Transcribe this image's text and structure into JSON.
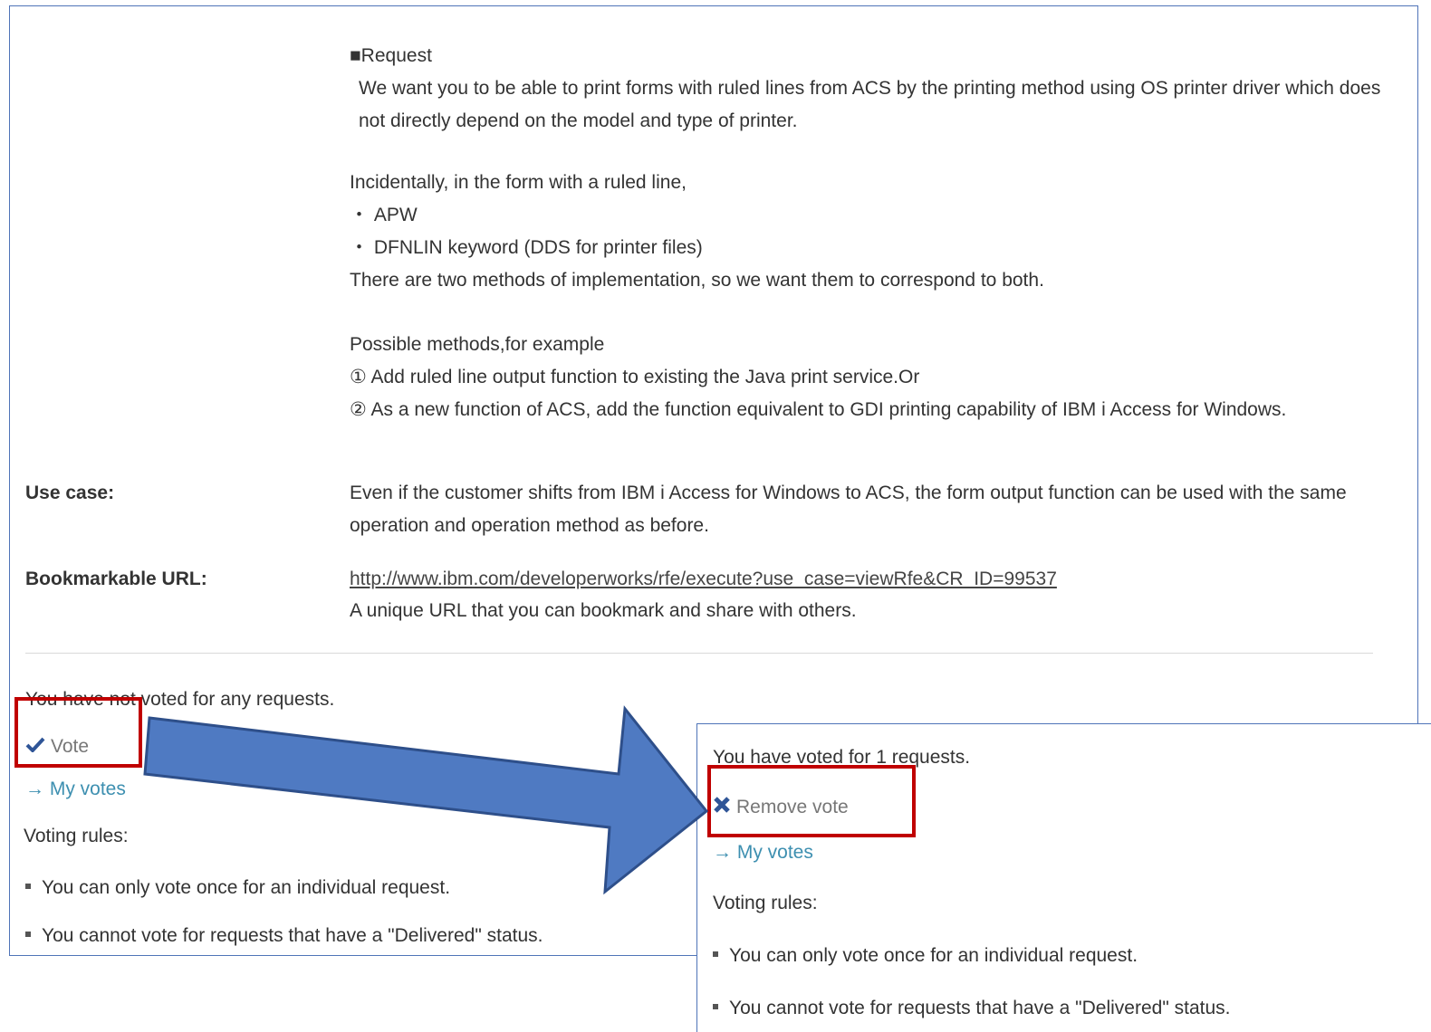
{
  "request": {
    "heading": "■Request",
    "paragraph1": "We want you to be able to print forms with ruled lines from ACS by the printing method using OS printer driver which does not directly depend on the model and type of printer.",
    "incidental_intro": "Incidentally, in the form with a ruled line,",
    "incidental_items": [
      "・ APW",
      "・ DFNLIN keyword (DDS for printer files)"
    ],
    "incidental_outro": "There are two methods of implementation, so we want them to correspond to both.",
    "methods_intro": "Possible methods,for example",
    "method1": "① Add ruled line output function to existing the Java print service.Or",
    "method2": "② As a new function of ACS, add the function equivalent to GDI printing capability of IBM i Access for Windows."
  },
  "use_case": {
    "label": "Use case:",
    "text": "Even if the customer shifts from IBM i Access for Windows to ACS, the form output function can be used with the same operation and operation method as before."
  },
  "bookmark": {
    "label": "Bookmarkable URL:",
    "url": "http://www.ibm.com/developerworks/rfe/execute?use_case=viewRfe&CR_ID=99537",
    "note": "A unique URL that you can bookmark and share with others."
  },
  "voting_before": {
    "status": "You have not voted for any requests.",
    "vote_label": "Vote",
    "my_votes_label": "→ My votes",
    "rules_title": "Voting rules:",
    "rules": [
      "You can only vote once for an individual request.",
      "You cannot vote for requests that have a \"Delivered\" status."
    ]
  },
  "voting_after": {
    "status": "You have voted for 1 requests.",
    "remove_label": "Remove vote",
    "my_votes_label": "→ My votes",
    "rules_title": "Voting rules:",
    "rules": [
      "You can only vote once for an individual request.",
      "You cannot vote for requests that have a \"Delivered\" status."
    ]
  },
  "colors": {
    "arrow_fill": "#4f7ac2",
    "arrow_stroke": "#2e4f8a",
    "highlight": "#c00000",
    "panel_border": "#4f74b8",
    "link_blue": "#3d8fb0",
    "checkmark": "#2f5597"
  }
}
